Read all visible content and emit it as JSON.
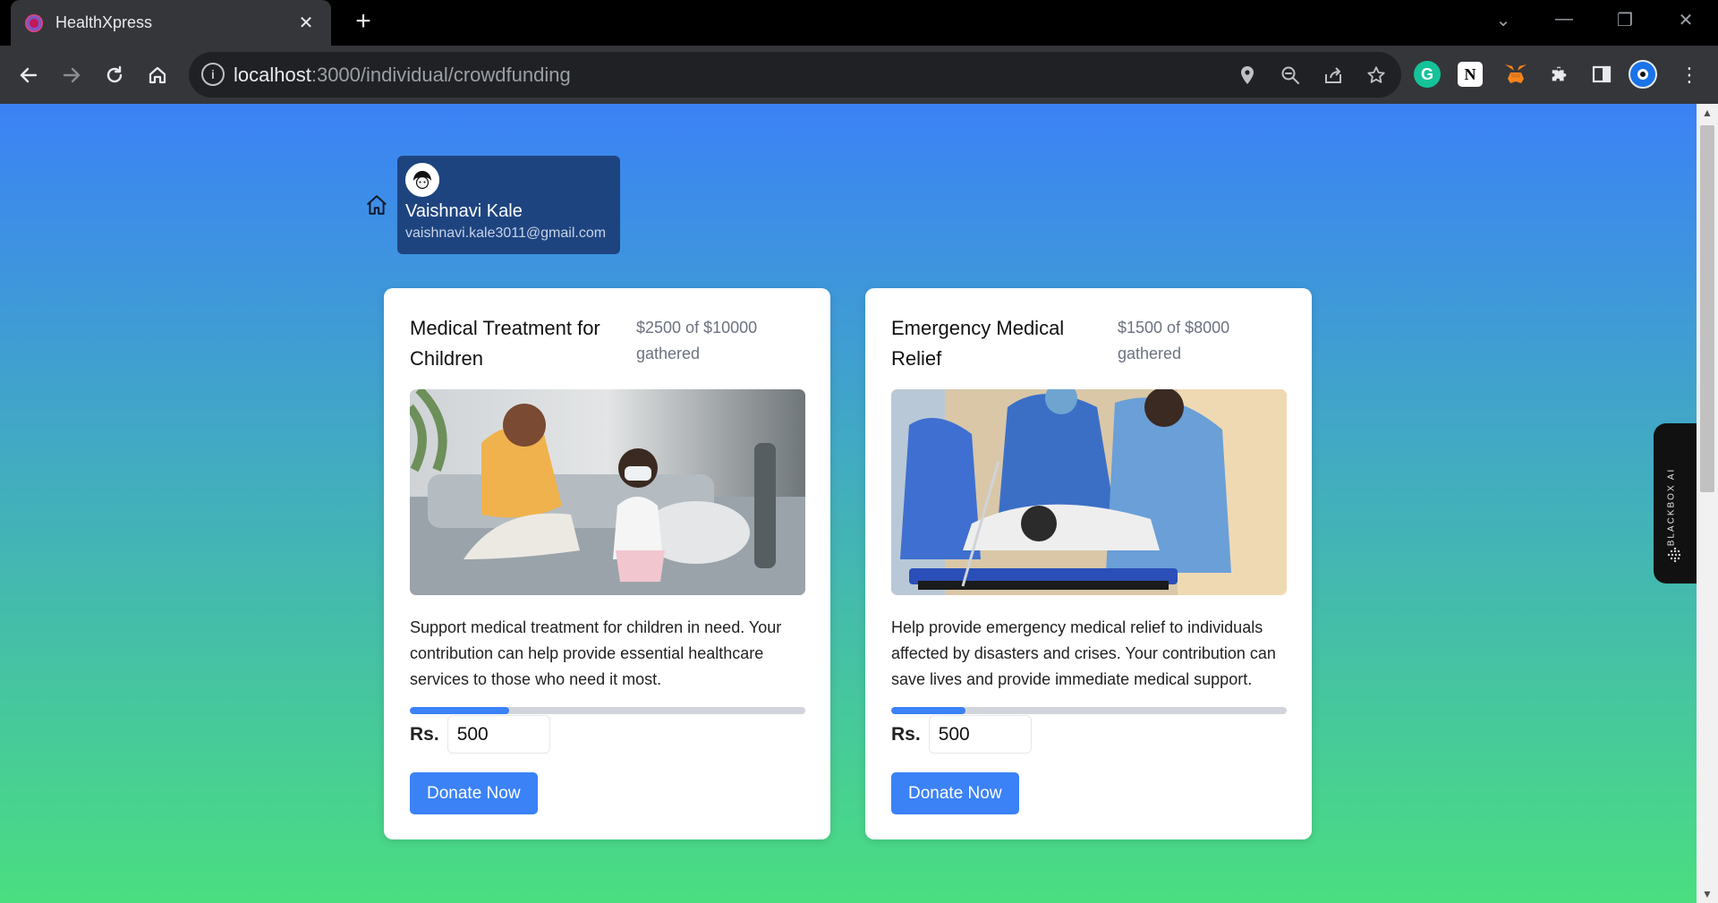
{
  "browser": {
    "tab_title": "HealthXpress",
    "url_host": "localhost",
    "url_path": ":3000/individual/crowdfunding"
  },
  "user": {
    "name": "Vaishnavi Kale",
    "email": "vaishnavi.kale3011@gmail.com"
  },
  "campaigns": [
    {
      "title": "Medical Treatment for Children",
      "goal_text": "$2500 of $10000 gathered",
      "description": "Support medical treatment for children in need. Your contribution can help provide essential healthcare services to those who need it most.",
      "progress": 0.25,
      "amount_label": "Rs.",
      "amount_value": "500",
      "button_label": "Donate Now"
    },
    {
      "title": "Emergency Medical Relief",
      "goal_text": "$1500 of $8000 gathered",
      "description": "Help provide emergency medical relief to individuals affected by disasters and crises. Your contribution can save lives and provide immediate medical support.",
      "progress": 0.1875,
      "amount_label": "Rs.",
      "amount_value": "500",
      "button_label": "Donate Now"
    }
  ],
  "extension_panel": {
    "label": "BLACKBOX AI"
  },
  "colors": {
    "gradient_top": "#3b82f6",
    "gradient_bottom": "#4ade80",
    "primary_button": "#3b82f6",
    "profile_bg": "#1e4480"
  }
}
